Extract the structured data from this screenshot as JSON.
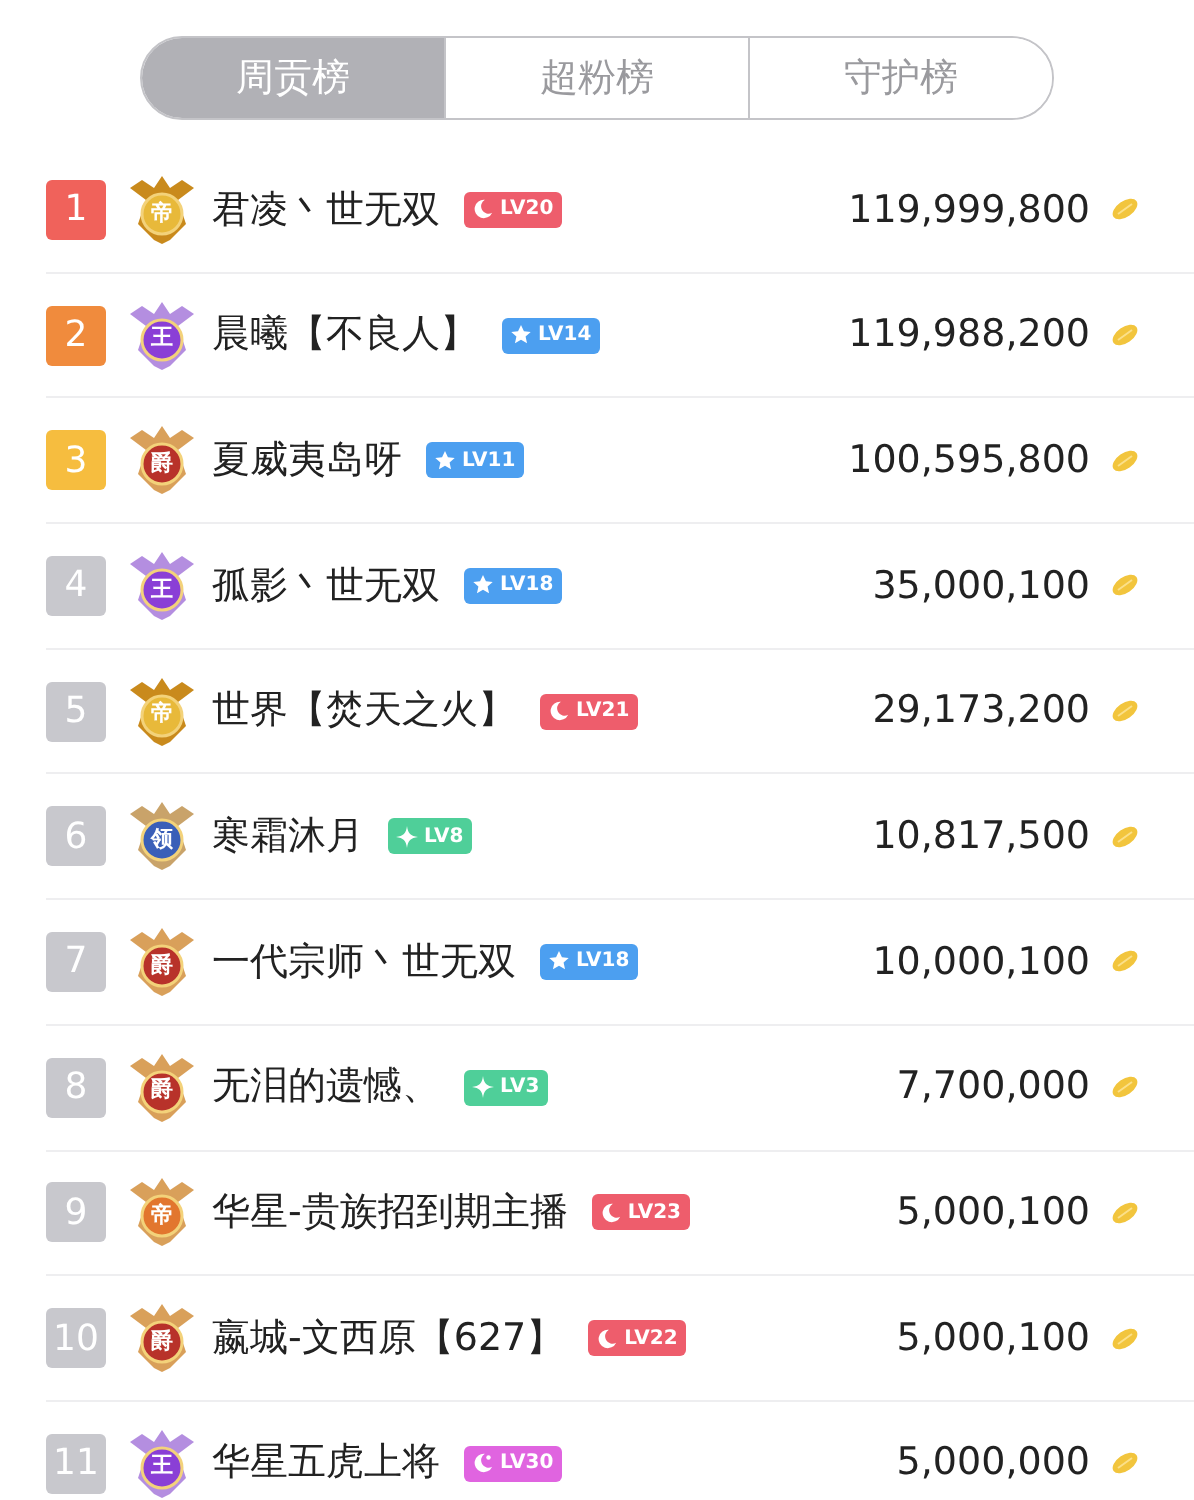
{
  "tabs": [
    {
      "label": "周贡榜",
      "selected": true
    },
    {
      "label": "超粉榜",
      "selected": false
    },
    {
      "label": "守护榜",
      "selected": false
    }
  ],
  "rows": [
    {
      "rank": "1",
      "medal": {
        "kind": "gold",
        "char": "帝"
      },
      "name": "君凌丶世无双",
      "level": {
        "kind": "moon",
        "text": "LV20"
      },
      "value": "119,999,800"
    },
    {
      "rank": "2",
      "medal": {
        "kind": "purple",
        "char": "王"
      },
      "name": "晨曦【不良人】",
      "level": {
        "kind": "star",
        "text": "LV14"
      },
      "value": "119,988,200"
    },
    {
      "rank": "3",
      "medal": {
        "kind": "red",
        "char": "爵"
      },
      "name": "夏威夷岛呀",
      "level": {
        "kind": "star",
        "text": "LV11"
      },
      "value": "100,595,800"
    },
    {
      "rank": "4",
      "medal": {
        "kind": "purple",
        "char": "王"
      },
      "name": "孤影丶世无双",
      "level": {
        "kind": "star",
        "text": "LV18"
      },
      "value": "35,000,100"
    },
    {
      "rank": "5",
      "medal": {
        "kind": "gold",
        "char": "帝"
      },
      "name": "世界【焚天之火】",
      "level": {
        "kind": "moon",
        "text": "LV21"
      },
      "value": "29,173,200"
    },
    {
      "rank": "6",
      "medal": {
        "kind": "blue",
        "char": "领"
      },
      "name": "寒霜沐月",
      "level": {
        "kind": "diamond",
        "text": "LV8"
      },
      "value": "10,817,500"
    },
    {
      "rank": "7",
      "medal": {
        "kind": "red",
        "char": "爵"
      },
      "name": "一代宗师丶世无双",
      "level": {
        "kind": "star",
        "text": "LV18"
      },
      "value": "10,000,100"
    },
    {
      "rank": "8",
      "medal": {
        "kind": "red",
        "char": "爵"
      },
      "name": "无泪的遗憾、",
      "level": {
        "kind": "diamond",
        "text": "LV3"
      },
      "value": "7,700,000"
    },
    {
      "rank": "9",
      "medal": {
        "kind": "orange",
        "char": "帝"
      },
      "name": "华星-贵族招到期主播",
      "level": {
        "kind": "moon",
        "text": "LV23"
      },
      "value": "5,000,100"
    },
    {
      "rank": "10",
      "medal": {
        "kind": "red",
        "char": "爵"
      },
      "name": "嬴城-文西原【627】",
      "level": {
        "kind": "moon",
        "text": "LV22"
      },
      "value": "5,000,100"
    },
    {
      "rank": "11",
      "medal": {
        "kind": "purple",
        "char": "王"
      },
      "name": "华星五虎上将",
      "level": {
        "kind": "fan",
        "text": "LV30"
      },
      "value": "5,000,000"
    }
  ]
}
